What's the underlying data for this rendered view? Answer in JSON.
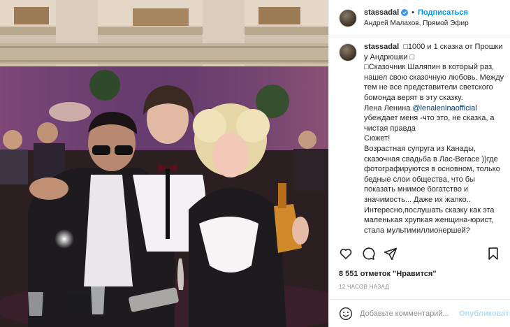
{
  "header": {
    "username": "stassadal",
    "separator": "•",
    "follow_label": "Подписаться",
    "location": "Андрей Малахов, Прямой Эфир",
    "verified_icon": "verified-badge-icon"
  },
  "caption": {
    "username": "stassadal",
    "lines": [
      "□1000 и 1 сказка от Прошки у Андрюшки □",
      "□Сказочник Шаляпин в который раз, нашел свою сказочную любовь. Между тем не все представители светского бомонда верят в эту сказку.",
      "Лена Ленина ",
      "Сюжет!",
      "Возрастная супруга из Канады, сказочная свадьба в Лас-Вегасе ))где фотографируются в основном, только бедные слои общества, что бы показать мнимое богатство и значимость... Даже их жалко.. Интересно,послушать сказку как эта маленькая хрупкая женщина-юрист, стала мультимиллионершей?"
    ],
    "mention": "@lenaleninaofficial",
    "mention_after": " убеждает меня -что это, не сказка, а чистая правда"
  },
  "actions": {
    "like_icon": "heart-icon",
    "comment_icon": "comment-icon",
    "share_icon": "share-icon",
    "save_icon": "bookmark-icon"
  },
  "likes_text": "8 551 отметок \"Нравится\"",
  "time_text": "12 ЧАСОВ НАЗАД",
  "add_comment": {
    "placeholder": "Добавьте комментарий...",
    "publish_label": "Опубликовать",
    "emoji_icon": "emoji-icon"
  },
  "colors": {
    "accent": "#0095f6",
    "publish_disabled": "#b2dffc",
    "verified": "#3897f0"
  }
}
